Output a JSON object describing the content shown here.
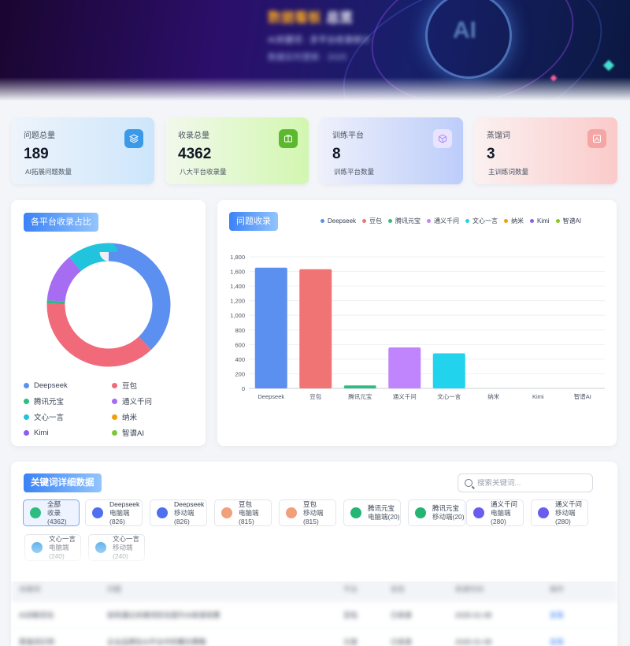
{
  "hero": {
    "title_accent": "数据看板",
    "title_main": "总览",
    "subtitle": "AI关键词 · 多平台收录统计",
    "subtitle2": "数据实时更新 · 2025",
    "logo_text": "AI"
  },
  "stats": [
    {
      "label": "问题总量",
      "value": "189",
      "desc": "AI拓展问题数量",
      "icon": "layers-icon",
      "color": "#3b9ae8"
    },
    {
      "label": "收录总量",
      "value": "4362",
      "desc": "八大平台收录量",
      "icon": "briefcase-icon",
      "color": "#5cb82f"
    },
    {
      "label": "训练平台",
      "value": "8",
      "desc": "训练平台数量",
      "icon": "cube-icon",
      "color": "#c4b5fd"
    },
    {
      "label": "蒸馏词",
      "value": "3",
      "desc": "主训练词数量",
      "icon": "image-icon",
      "color": "#f39b9b"
    }
  ],
  "donut": {
    "title": "各平台收录占比",
    "legend": [
      {
        "name": "Deepseek",
        "color": "#5b8ff0"
      },
      {
        "name": "豆包",
        "color": "#f06a7a"
      },
      {
        "name": "腾讯元宝",
        "color": "#2dbd82"
      },
      {
        "name": "通义千问",
        "color": "#a66cf2"
      },
      {
        "name": "文心一言",
        "color": "#22c3dd"
      },
      {
        "name": "纳米",
        "color": "#f59e0b"
      },
      {
        "name": "Kimi",
        "color": "#8b5cf6"
      },
      {
        "name": "智谱AI",
        "color": "#7cc83a"
      }
    ]
  },
  "bar": {
    "title": "问题收录"
  },
  "chart_data": {
    "type": "bar",
    "categories": [
      "Deepseek",
      "豆包",
      "腾讯元宝",
      "通义千问",
      "文心一言",
      "纳米",
      "Kimi",
      "智谱AI"
    ],
    "values": [
      1652,
      1630,
      40,
      560,
      480,
      0,
      0,
      0
    ],
    "colors": [
      "#5b8ff0",
      "#f07474",
      "#2dbd82",
      "#c084fc",
      "#22d3ee",
      "#f59e0b",
      "#8b5cf6",
      "#84cc16"
    ],
    "ylim": [
      0,
      1800
    ],
    "yticks": [
      "0",
      "200",
      "400",
      "600",
      "800",
      "1,000",
      "1,200",
      "1,400",
      "1,600",
      "1,800"
    ],
    "grid": true,
    "legend_position": "top-right"
  },
  "keywords": {
    "title": "关键词详细数据",
    "search_placeholder": "搜索关键词...",
    "chips": [
      {
        "title": "全部",
        "sub": "收录(4362)",
        "color": "#2dbd82",
        "icon": "all-icon"
      },
      {
        "title": "Deepseek",
        "sub": "电脑端(826)",
        "color": "#4f6ef0",
        "icon": "deepseek-icon"
      },
      {
        "title": "Deepseek",
        "sub": "移动端(826)",
        "color": "#4f6ef0",
        "icon": "deepseek-icon"
      },
      {
        "title": "豆包",
        "sub": "电脑端(815)",
        "color": "#f0a07a",
        "icon": "doubao-icon"
      },
      {
        "title": "豆包",
        "sub": "移动端(815)",
        "color": "#f0a07a",
        "icon": "doubao-icon"
      },
      {
        "title": "腾讯元宝",
        "sub": "电脑端(20)",
        "color": "#22b573",
        "icon": "yuanbao-icon"
      },
      {
        "title": "腾讯元宝",
        "sub": "移动端(20)",
        "color": "#22b573",
        "icon": "yuanbao-icon"
      },
      {
        "title": "通义千问",
        "sub": "电脑端(280)",
        "color": "#6b5cf0",
        "icon": "tongyi-icon"
      },
      {
        "title": "通义千问",
        "sub": "移动端(280)",
        "color": "#6b5cf0",
        "icon": "tongyi-icon"
      },
      {
        "title": "文心一言",
        "sub": "电脑端(240)",
        "color": "#3aa0e8",
        "icon": "wenxin-icon"
      },
      {
        "title": "文心一言",
        "sub": "移动端(240)",
        "color": "#3aa0e8",
        "icon": "wenxin-icon"
      }
    ],
    "table_headers": [
      "关键词",
      "问题",
      "平台",
      "状态",
      "收录时间",
      "操作"
    ],
    "table_rows": [
      [
        "AI训练优化",
        "如何通过关键词优化提升AI收录效果",
        "豆包",
        "已收录",
        "2025-01-08",
        "查看"
      ],
      [
        "蒸馏词示例",
        "企业品牌在AI平台中的曝光策略",
        "元宝",
        "已收录",
        "2025-01-08",
        "查看"
      ]
    ]
  }
}
